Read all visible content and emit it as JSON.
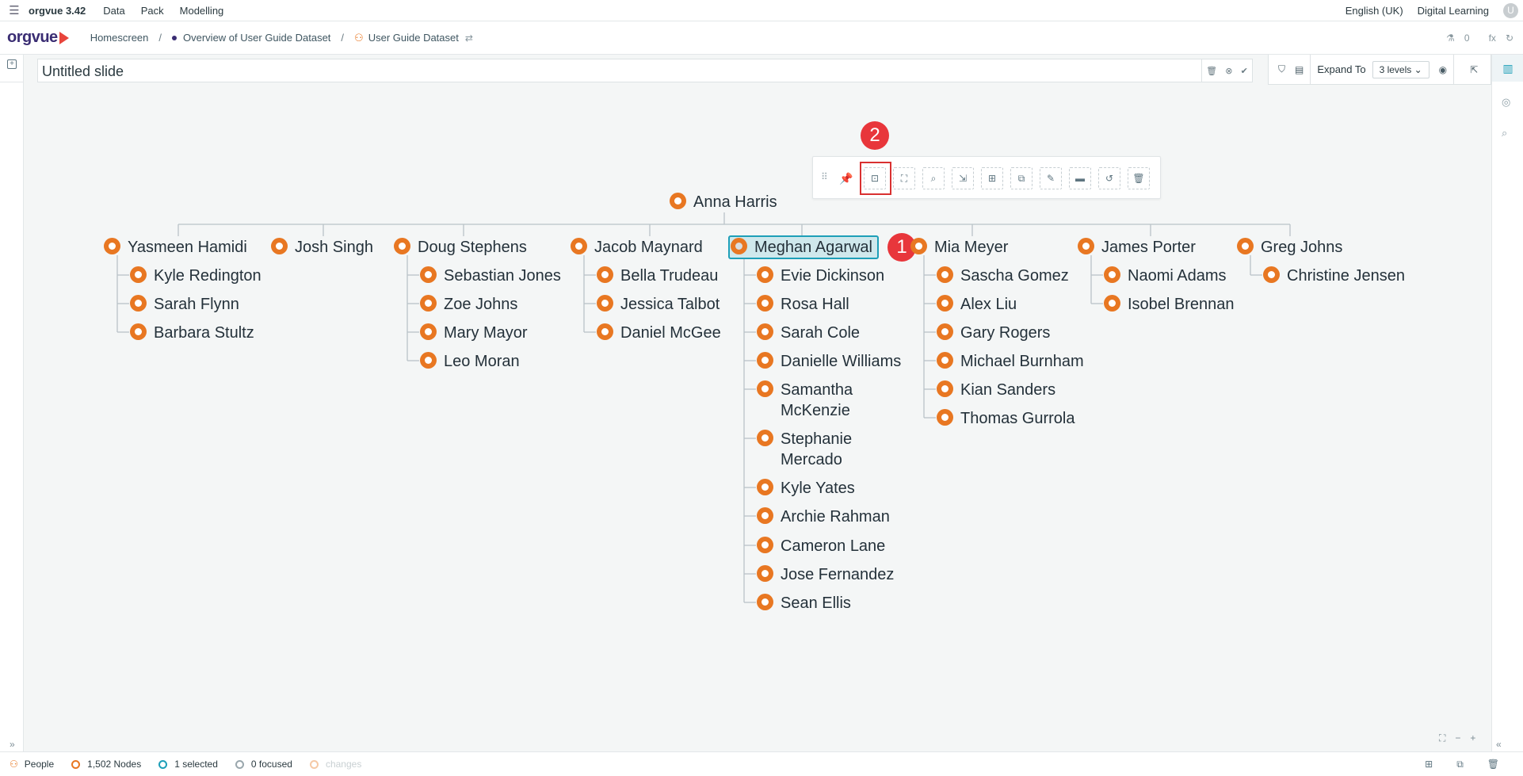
{
  "menubar": {
    "app_name": "orgvue 3.42",
    "items": [
      "Data",
      "Pack",
      "Modelling"
    ],
    "language": "English (UK)",
    "learning": "Digital Learning",
    "avatar_initial": "U"
  },
  "navbar": {
    "logo": "orgvue",
    "crumbs": [
      "Homescreen",
      "Overview of User Guide Dataset",
      "User Guide Dataset"
    ],
    "separator": "/",
    "flask_count": "0",
    "fx": "fx"
  },
  "slide": {
    "title": "Untitled slide"
  },
  "toolbox": {
    "expand_label": "Expand To",
    "expand_value": "3 levels"
  },
  "callouts": [
    "1",
    "2"
  ],
  "tree": {
    "root": "Anna Harris",
    "columns": [
      {
        "manager": "Yasmeen Hamidi",
        "reports": [
          "Kyle Redington",
          "Sarah Flynn",
          "Barbara Stultz"
        ]
      },
      {
        "manager": "Josh Singh",
        "reports": []
      },
      {
        "manager": "Doug Stephens",
        "reports": [
          "Sebastian Jones",
          "Zoe Johns",
          "Mary Mayor",
          "Leo Moran"
        ]
      },
      {
        "manager": "Jacob Maynard",
        "reports": [
          "Bella Trudeau",
          "Jessica Talbot",
          "Daniel McGee"
        ]
      },
      {
        "manager": "Meghan Agarwal",
        "reports": [
          "Evie Dickinson",
          "Rosa Hall",
          "Sarah Cole",
          "Danielle Williams",
          "Samantha McKenzie",
          "Stephanie Mercado",
          "Kyle Yates",
          "Archie Rahman",
          "Cameron Lane",
          "Jose Fernandez",
          "Sean Ellis"
        ]
      },
      {
        "manager": "Mia Meyer",
        "reports": [
          "Sascha Gomez",
          "Alex Liu",
          "Gary Rogers",
          "Michael Burnham",
          "Kian Sanders",
          "Thomas Gurrola"
        ]
      },
      {
        "manager": "James Porter",
        "reports": [
          "Naomi Adams",
          "Isobel Brennan"
        ]
      },
      {
        "manager": "Greg Johns",
        "reports": [
          "Christine Jensen"
        ]
      }
    ]
  },
  "status": {
    "dataset": "People",
    "nodes": "1,502 Nodes",
    "selected": "1 selected",
    "focused": "0 focused",
    "changes": "changes"
  },
  "colors": {
    "node_orange": "#e87722",
    "selection_teal": "#1e9fb8",
    "callout_red": "#e8363b",
    "brand_purple": "#3a2d73"
  }
}
